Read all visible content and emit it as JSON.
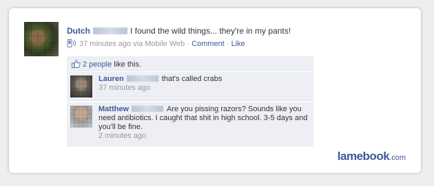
{
  "post": {
    "author": "Dutch",
    "text": "I found the wild things... they're in my pants!",
    "timestamp": "37 minutes ago",
    "via": "via Mobile Web",
    "comment_link": "Comment",
    "separator": "·",
    "like_link": "Like"
  },
  "likes": {
    "count_text": "2 people",
    "suffix": " like this."
  },
  "comments": [
    {
      "author": "Lauren",
      "text": "that's called crabs",
      "timestamp": "37 minutes ago"
    },
    {
      "author": "Matthew",
      "text": "Are you pissing razors? Sounds like you need antibiotics. I caught that shit in high school. 3-5 days and you'll be fine.",
      "timestamp": "2 minutes ago"
    }
  ],
  "watermark": {
    "brand": "lamebook",
    "domain": ".com"
  },
  "colors": {
    "link": "#3b5998",
    "comment_bg": "#edeff4",
    "meta_text": "#999999"
  },
  "icons": [
    "mobile-phone-icon",
    "thumbs-up-icon"
  ]
}
